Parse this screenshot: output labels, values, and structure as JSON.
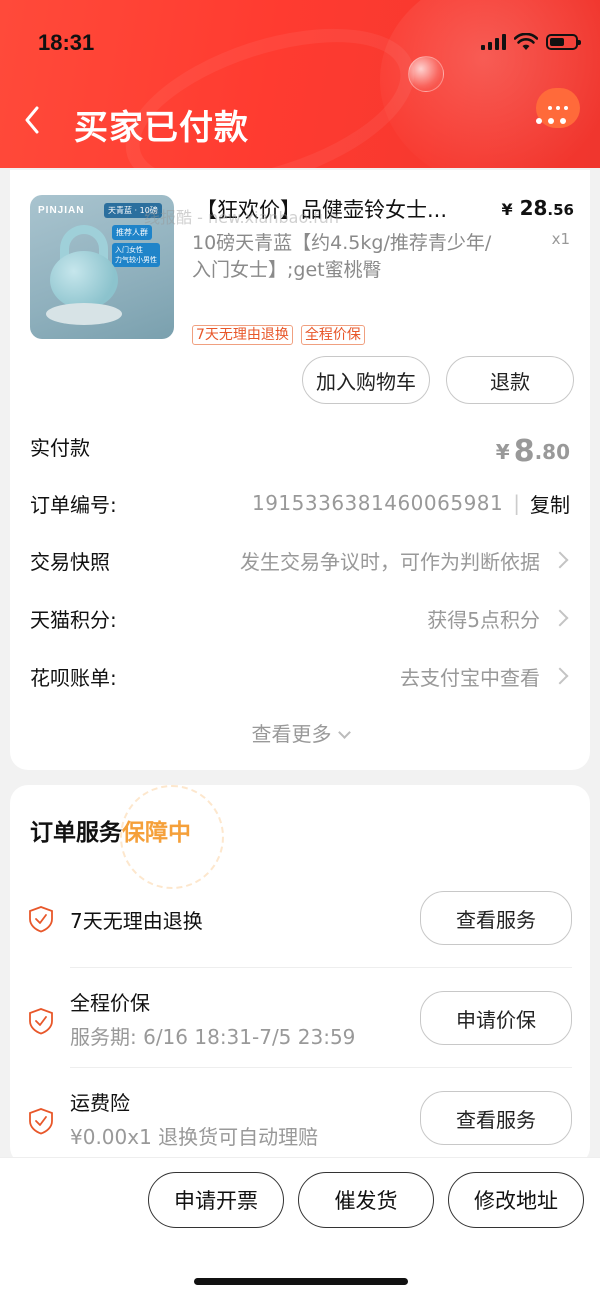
{
  "status_bar": {
    "time": "18:31"
  },
  "header": {
    "title": "买家已付款",
    "back_icon": "chevron-left-icon",
    "more_icon": "more-dots-icon"
  },
  "product": {
    "title": "【狂欢价】品健壶铃女士...",
    "sku": "10磅天青蓝【约4.5kg/推荐青少年/入门女士】;get蜜桃臀",
    "watermark": "线报酷 - new.xianbao.fun",
    "price_symbol": "¥",
    "price_int": "28",
    "price_dec": ".56",
    "quantity": "x1",
    "badges": [
      "7天无理由退换",
      "全程价保"
    ],
    "image_texts": {
      "brand": "PINJIAN",
      "tag1": "天青蓝 · 10磅",
      "tag2": "推荐人群",
      "tag3": "入门女性\n力气较小男性"
    },
    "buttons": {
      "add_to_cart": "加入购物车",
      "refund": "退款"
    }
  },
  "order": {
    "paid_label": "实付款",
    "paid_symbol": "¥",
    "paid_int": "8",
    "paid_dec": ".80",
    "rows": [
      {
        "label": "订单编号:",
        "value": "1915336381460065981",
        "action": "复制"
      },
      {
        "label": "交易快照",
        "value": "发生交易争议时，可作为判断依据"
      },
      {
        "label": "天猫积分:",
        "value": "获得5点积分"
      },
      {
        "label": "花呗账单:",
        "value": "去支付宝中查看"
      }
    ],
    "see_more": "查看更多"
  },
  "services": {
    "title_prefix": "订单服务",
    "title_highlight": "保障中",
    "items": [
      {
        "name": "7天无理由退换",
        "sub": "",
        "button": "查看服务",
        "icon": "shield-check-icon"
      },
      {
        "name": "全程价保",
        "sub": "服务期: 6/16 18:31-7/5 23:59",
        "button": "申请价保",
        "icon": "shield-check-icon"
      },
      {
        "name": "运费险",
        "sub": "¥0.00x1 退换货可自动理赔",
        "button": "查看服务",
        "icon": "shield-check-icon"
      }
    ]
  },
  "bottom_bar": {
    "invoice": "申请开票",
    "urge": "催发货",
    "address": "修改地址"
  },
  "colors": {
    "header_red": "#ff3b30",
    "accent_orange": "#e8572a",
    "guarantee_gold": "#f5a03a"
  }
}
